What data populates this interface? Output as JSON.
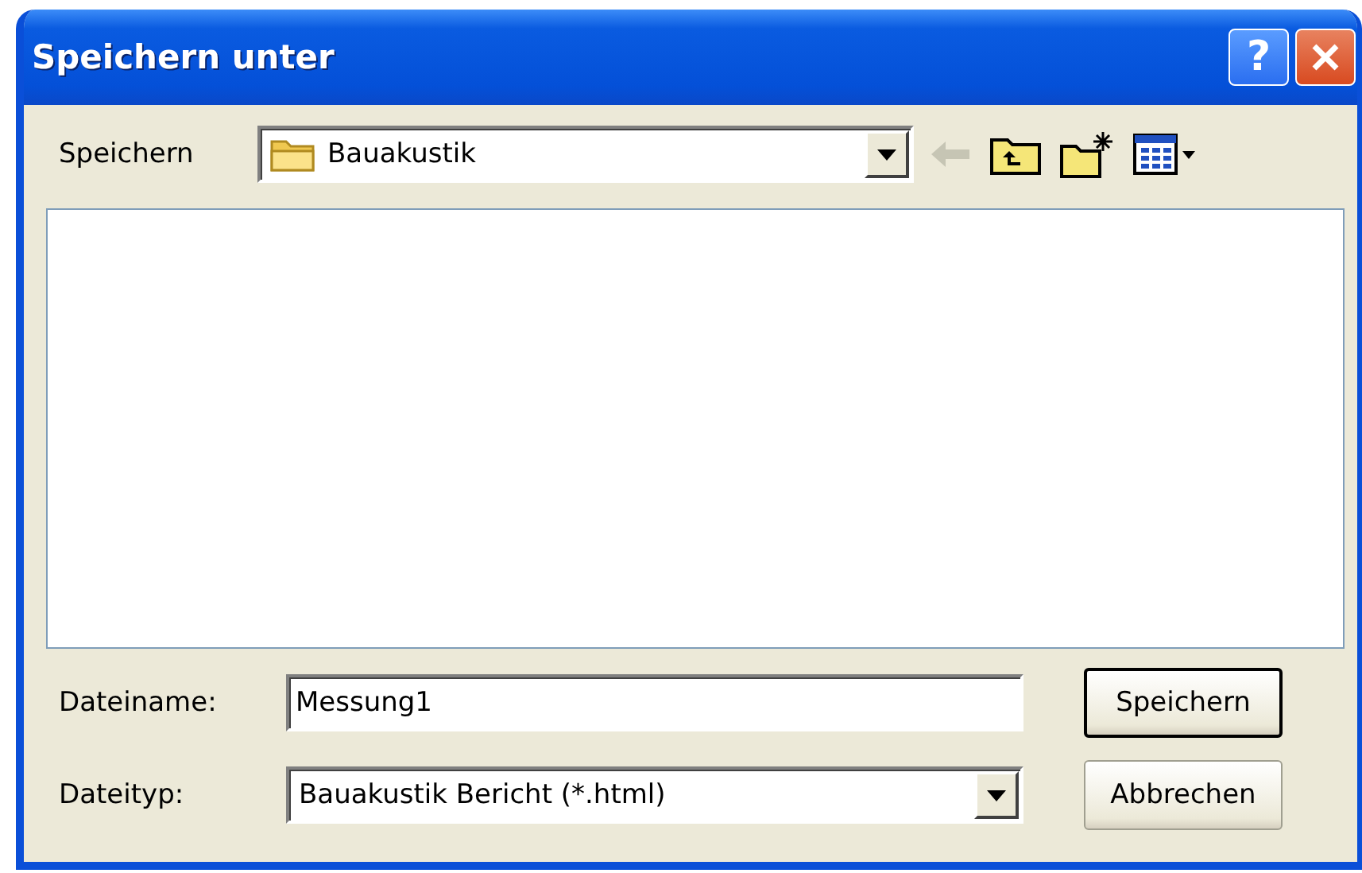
{
  "window": {
    "title": "Speichern unter",
    "buttons": [
      {
        "kind": "help",
        "label": "?"
      },
      {
        "kind": "close"
      }
    ]
  },
  "save_in": {
    "label": "Speichern",
    "value": "Bauakustik"
  },
  "toolbar": [
    {
      "kind": "back",
      "disabled": true
    },
    {
      "kind": "up",
      "disabled": false
    },
    {
      "kind": "new-folder",
      "disabled": false
    },
    {
      "kind": "views",
      "disabled": false
    }
  ],
  "file_name": {
    "label": "Dateiname:",
    "value": "Messung1"
  },
  "file_type": {
    "label": "Dateityp:",
    "value": "Bauakustik Bericht (*.html)"
  },
  "buttons": [
    {
      "label": "Speichern",
      "default": true
    },
    {
      "label": "Abbrechen",
      "default": false
    }
  ]
}
